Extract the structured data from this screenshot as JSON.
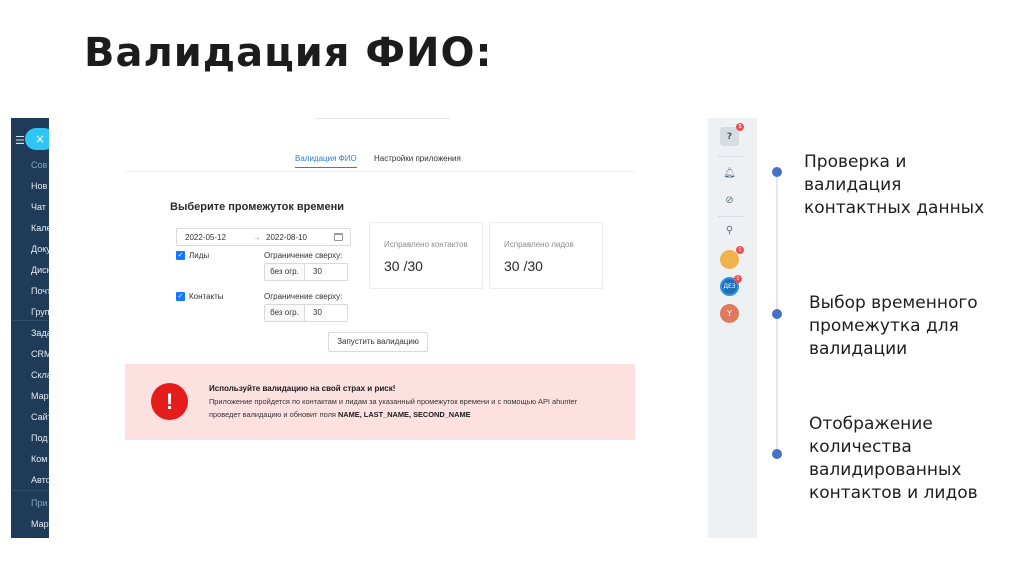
{
  "slide": {
    "title": "Валидация ФИО:"
  },
  "left_nav": {
    "items": [
      {
        "label": "Сов",
        "section": true
      },
      {
        "label": "Нов"
      },
      {
        "label": "Чат"
      },
      {
        "label": "Кале"
      },
      {
        "label": "Доку"
      },
      {
        "label": "Диск"
      },
      {
        "label": "Почт"
      },
      {
        "label": "Груп"
      },
      {
        "label": "Зада"
      },
      {
        "label": "CRM"
      },
      {
        "label": "Скла"
      },
      {
        "label": "Мар"
      },
      {
        "label": "Сайт"
      },
      {
        "label": "Под"
      },
      {
        "label": "Ком"
      },
      {
        "label": "Авто"
      },
      {
        "label": "При",
        "section": true
      },
      {
        "label": "Мар"
      }
    ]
  },
  "app": {
    "tabs": [
      {
        "label": "Валидация ФИО",
        "active": true
      },
      {
        "label": "Настройки приложения",
        "active": false
      }
    ],
    "section_title": "Выберите промежуток времени",
    "date_range": {
      "start": "2022-05-12",
      "separator": "→",
      "end": "2022-08-10"
    },
    "filters": [
      {
        "label": "Лиды",
        "checked": true,
        "limit_label": "Ограничение сверху:",
        "limit_addon": "без огр.",
        "limit_value": "30"
      },
      {
        "label": "Контакты",
        "checked": true,
        "limit_label": "Ограничение сверху:",
        "limit_addon": "без огр.",
        "limit_value": "30"
      }
    ],
    "stats": [
      {
        "label": "Исправлено контактов",
        "value": "30 /30"
      },
      {
        "label": "Исправлено лидов",
        "value": "30 /30"
      }
    ],
    "run_button": "Запустить валидацию",
    "alert": {
      "icon": "!",
      "title": "Используйте валидацию на свой страх и риск!",
      "line1": "Приложение пройдется по контактам и лидам за указанный промежуток времени и с помощью API ahunter",
      "line2_prefix": "проведет валидацию и обновит поля ",
      "line2_fields": "NAME, LAST_NAME, SECOND_NAME"
    }
  },
  "right_strip": {
    "help_label": "?",
    "help_badge": "1",
    "avatar_a_badge": "1",
    "avatar_b_label": "ДЕЗ",
    "avatar_b_badge": "1",
    "avatar_y_label": "Y",
    "icons": [
      "help-icon",
      "bell-icon",
      "timer-icon",
      "search-icon",
      "user-avatar",
      "group-avatar",
      "profile-avatar"
    ]
  },
  "annotations": [
    "Проверка и валидация контактных данных",
    "Выбор временного промежутка для валидации",
    "Отображение количества валидированных контактов и лидов"
  ],
  "colors": {
    "sidebar_bg": "#1f3b57",
    "accent": "#2f7fd0",
    "alert_bg": "#fde1e1",
    "alert_icon": "#e51c1c",
    "timeline_dot": "#4472c4"
  }
}
